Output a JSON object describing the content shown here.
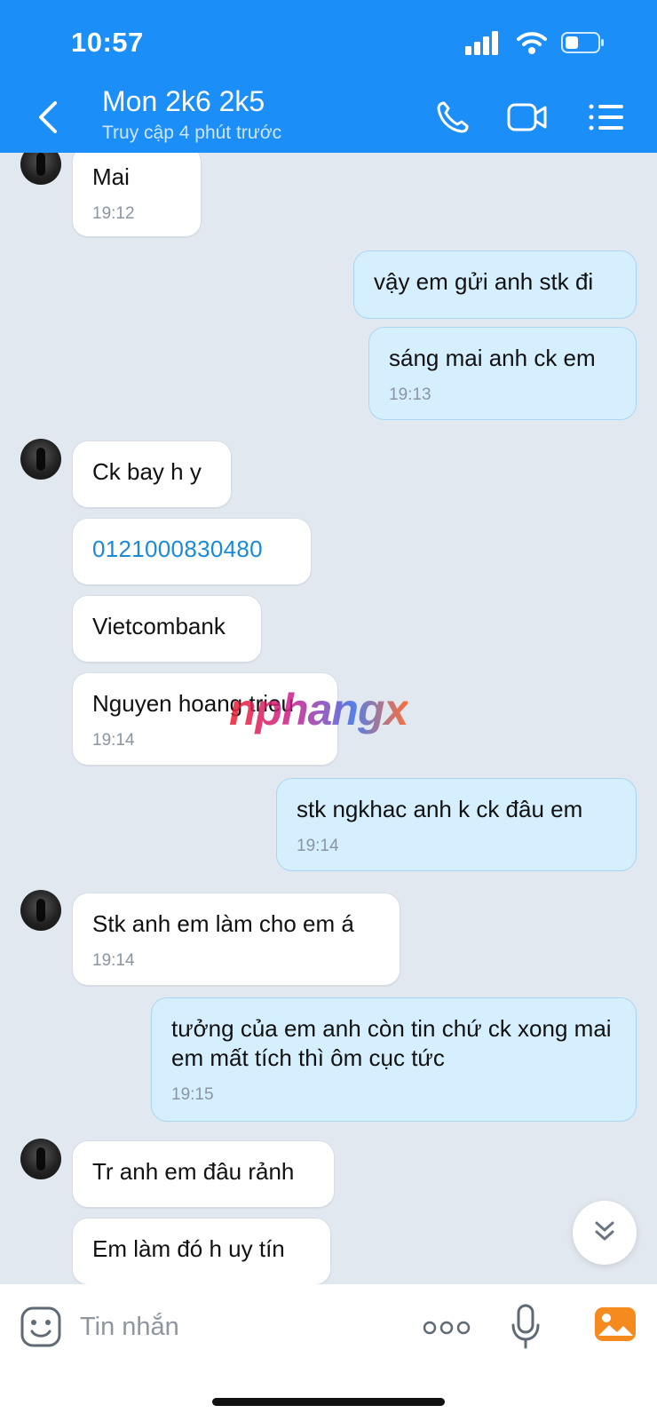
{
  "status_bar": {
    "time": "10:57",
    "icons": [
      "signal-icon",
      "wifi-icon",
      "battery-icon"
    ]
  },
  "header": {
    "title": "Mon 2k6 2k5",
    "subtitle": "Truy cập 4 phút trước",
    "icons": [
      "back-icon",
      "phone-icon",
      "video-icon",
      "menu-icon"
    ]
  },
  "messages": [
    {
      "dir": "in",
      "text": "Mai",
      "time": "19:12"
    },
    {
      "dir": "out",
      "text": "vậy em gửi anh stk đi",
      "time": ""
    },
    {
      "dir": "out",
      "text": "sáng mai anh ck em",
      "time": "19:13"
    },
    {
      "dir": "in",
      "text": "Ck bay h y",
      "time": ""
    },
    {
      "dir": "in",
      "text": "0121000830480",
      "time": "",
      "link": true
    },
    {
      "dir": "in",
      "text": "Vietcombank",
      "time": ""
    },
    {
      "dir": "in",
      "text": "Nguyen hoang trieu",
      "time": "19:14"
    },
    {
      "dir": "out",
      "text": "stk ngkhac anh k ck đâu em",
      "time": "19:14"
    },
    {
      "dir": "in",
      "text": "Stk anh em làm cho em á",
      "time": "19:14"
    },
    {
      "dir": "out",
      "text": "tưởng của em anh còn tin chứ ck xong mai em mất tích thì ôm cục tức",
      "time": "19:15"
    },
    {
      "dir": "in",
      "text": "Tr anh em đâu rảnh",
      "time": ""
    },
    {
      "dir": "in",
      "text": "Em làm đó h uy tín",
      "time": ""
    }
  ],
  "watermark": "nphangx",
  "composer": {
    "placeholder": "Tin nhắn",
    "icons": [
      "sticker-icon",
      "more-icon",
      "microphone-icon",
      "image-icon"
    ]
  },
  "colors": {
    "header": "#1b8ef7",
    "chat_bg": "#e2e8ef",
    "outgoing_bubble": "#d6efff",
    "incoming_bubble": "#ffffff",
    "link": "#1a8ad8"
  }
}
